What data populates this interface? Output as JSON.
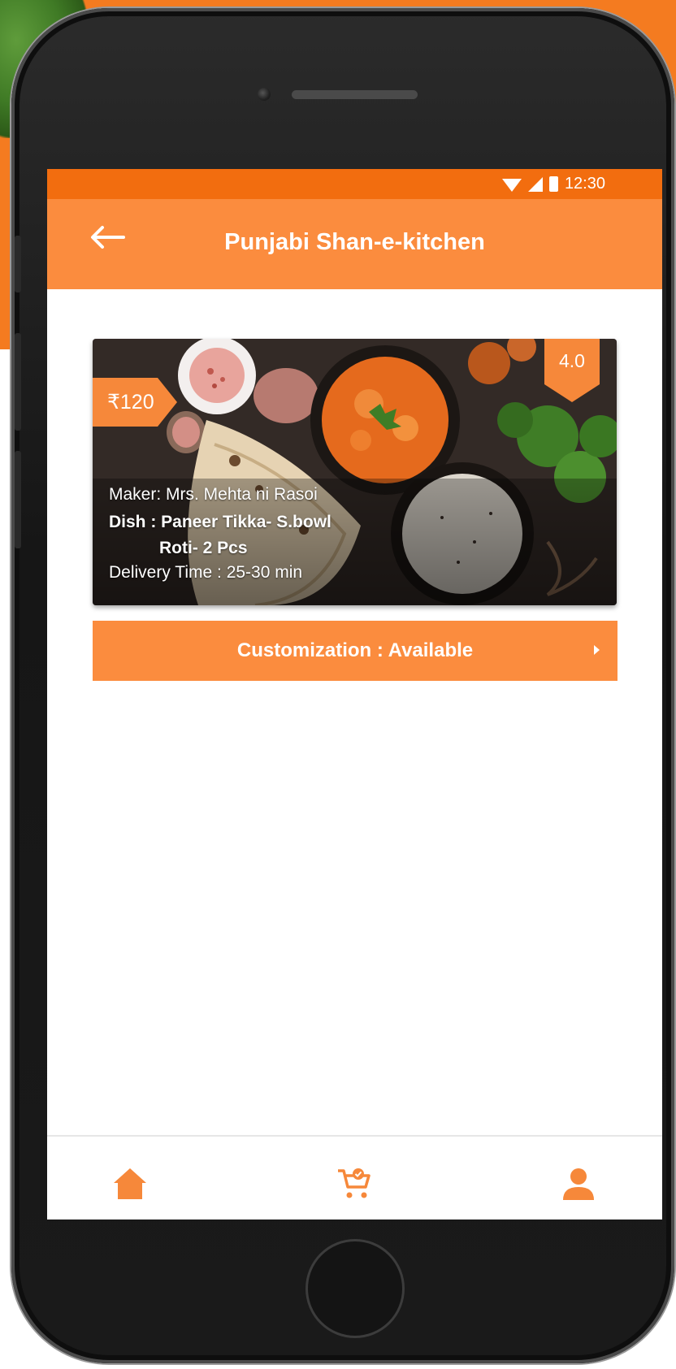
{
  "status_bar": {
    "time": "12:30"
  },
  "app_bar": {
    "title": "Punjabi Shan-e-kitchen"
  },
  "dish_card": {
    "price": "₹120",
    "rating": "4.0",
    "maker": "Maker: Mrs. Mehta ni Rasoi",
    "dish_line1": "Dish : Paneer Tikka- S.bowl",
    "dish_line2": "Roti- 2 Pcs",
    "delivery": "Delivery Time : 25-30 min"
  },
  "customization": {
    "label": "Customization : Available"
  },
  "bottom_nav": {
    "items": [
      "home-icon",
      "cart-icon",
      "profile-icon"
    ]
  },
  "colors": {
    "accent": "#fb8c3e",
    "status_bar": "#f26d0f",
    "background": "#f47b20"
  }
}
